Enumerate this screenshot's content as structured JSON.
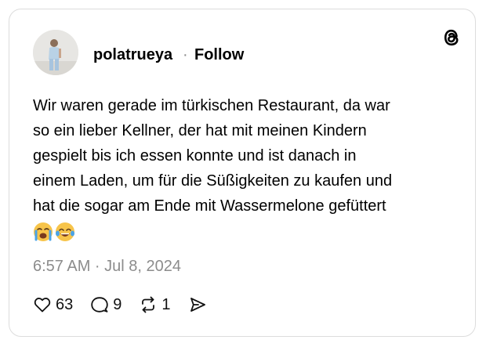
{
  "post": {
    "username": "polatrueya",
    "separator": "·",
    "follow_label": "Follow",
    "text": "Wir waren gerade im türkischen Restaurant, da war\nso ein lieber Kellner, der hat mit meinen Kindern\ngespielt bis ich essen konnte und ist danach in\neinem Laden, um für die Süßigkeiten zu kaufen und\nhat die sogar am Ende mit Wassermelone gefüttert",
    "emojis": [
      "loudly-crying-face",
      "tears-of-joy-face"
    ],
    "timestamp": "6:57 AM · Jul 8, 2024"
  },
  "actions": {
    "likes": "63",
    "replies": "9",
    "reposts": "1"
  },
  "icons": {
    "brand": "threads-logo-icon",
    "like": "heart-icon",
    "reply": "comment-bubble-icon",
    "repost": "repost-icon",
    "share": "send-icon"
  },
  "colors": {
    "text": "#000000",
    "muted": "#8c8c8c",
    "border": "#dcdcdc",
    "emoji_yellow": "#f7c44a",
    "tear_blue": "#4aa3e8"
  }
}
